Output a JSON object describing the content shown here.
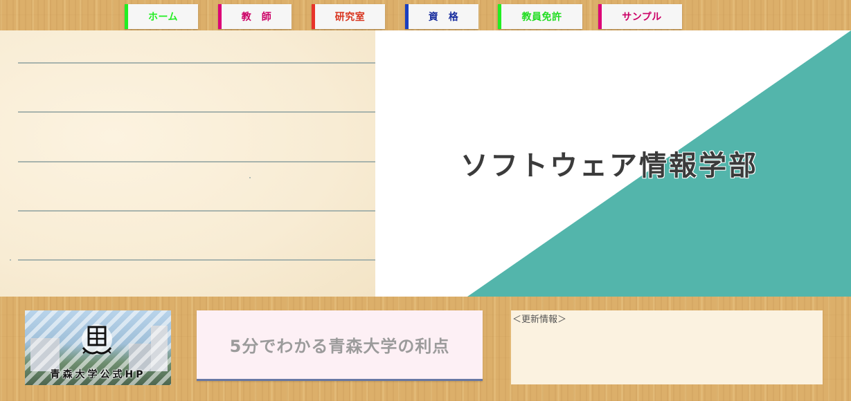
{
  "nav": {
    "items": [
      {
        "label": "ホーム",
        "color": "#22ee22",
        "text_color": "#22ee22"
      },
      {
        "label": "教　師",
        "color": "#dd0077",
        "text_color": "#cc0066"
      },
      {
        "label": "研究室",
        "color": "#e8342a",
        "text_color": "#d8341e"
      },
      {
        "label": "資　格",
        "color": "#1a3fbf",
        "text_color": "#1a2f9f"
      },
      {
        "label": "教員免許",
        "color": "#22ee22",
        "text_color": "#22dd22"
      },
      {
        "label": "サンプル",
        "color": "#dd0077",
        "text_color": "#cc0066"
      }
    ]
  },
  "hero": {
    "title": "ソフトウェア情報学部",
    "accent_color": "#53b5ab"
  },
  "logo_card": {
    "caption": "青森大学公式HP"
  },
  "promo": {
    "label": "5分でわかる青森大学の利点"
  },
  "news": {
    "heading": "＜更新情報＞"
  }
}
